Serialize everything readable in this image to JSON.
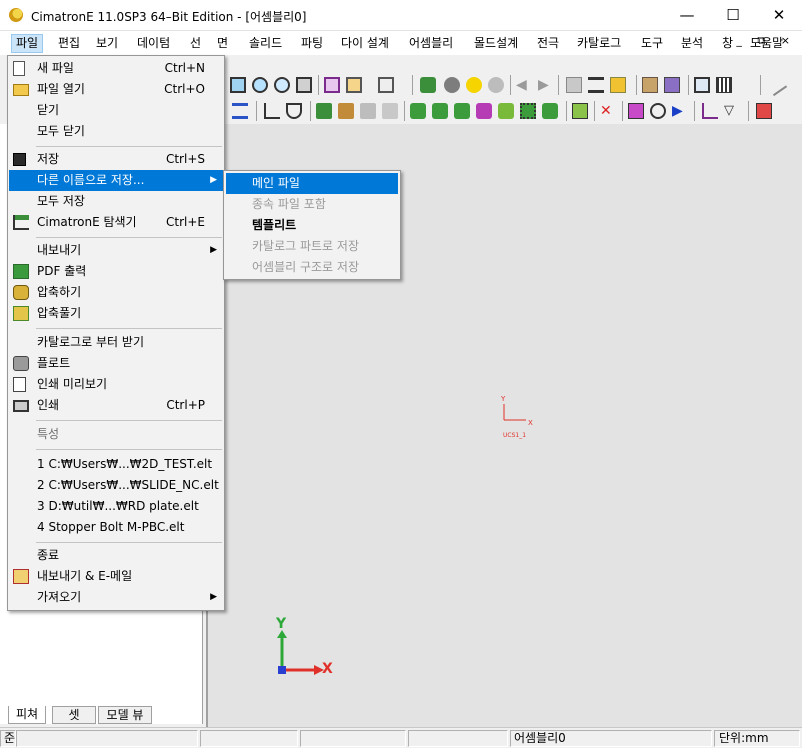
{
  "window": {
    "title": "CimatronE 11.0SP3 64–Bit Edition - [어셈블리0]",
    "minimize_glyph": "—",
    "maximize_glyph": "☐",
    "close_glyph": "✕",
    "mdi_controls": "_ ⧉ ×"
  },
  "menubar": {
    "items": [
      "파일",
      "편집",
      "보기",
      "데이텀",
      "선",
      "면",
      "솔리드",
      "파팅",
      "다이 설계",
      "어셈블리",
      "몰드설계",
      "전극",
      "카탈로그",
      "도구",
      "분석",
      "창",
      "도움말"
    ],
    "active_index": 0
  },
  "file_menu": {
    "items": [
      {
        "label": "새 파일",
        "shortcut": "Ctrl+N",
        "icon": "new-file-icon"
      },
      {
        "label": "파일 열기",
        "shortcut": "Ctrl+O",
        "icon": "open-folder-icon"
      },
      {
        "label": "닫기",
        "shortcut": ""
      },
      {
        "label": "모두 닫기",
        "shortcut": ""
      },
      {
        "label": "저장",
        "shortcut": "Ctrl+S",
        "icon": "floppy-disk-icon"
      },
      {
        "label": "다른 이름으로 저장...",
        "shortcut": "",
        "submenu": true
      },
      {
        "label": "모두 저장",
        "shortcut": ""
      },
      {
        "label": "CimatronE 탐색기",
        "shortcut": "Ctrl+E",
        "icon": "explorer-tree-icon"
      },
      {
        "label": "내보내기",
        "shortcut": "",
        "submenu": true
      },
      {
        "label": "PDF 출력",
        "shortcut": "",
        "icon": "pdf-output-icon"
      },
      {
        "label": "압축하기",
        "shortcut": "",
        "icon": "compress-icon"
      },
      {
        "label": "압축풀기",
        "shortcut": "",
        "icon": "extract-icon"
      },
      {
        "label": "카탈로그로 부터 받기",
        "shortcut": ""
      },
      {
        "label": "플로트",
        "shortcut": "",
        "icon": "plotter-icon"
      },
      {
        "label": "인쇄 미리보기",
        "shortcut": "",
        "icon": "print-preview-icon"
      },
      {
        "label": "인쇄",
        "shortcut": "Ctrl+P",
        "icon": "printer-icon"
      },
      {
        "label": "특성",
        "shortcut": "",
        "disabled": true
      },
      {
        "label": "1 C:₩Users₩...₩2D_TEST.elt",
        "shortcut": ""
      },
      {
        "label": "2 C:₩Users₩...₩SLIDE_NC.elt",
        "shortcut": ""
      },
      {
        "label": "3 D:₩util₩...₩RD plate.elt",
        "shortcut": ""
      },
      {
        "label": "4 Stopper Bolt M-PBC.elt",
        "shortcut": ""
      },
      {
        "label": "종료",
        "shortcut": ""
      },
      {
        "label": "내보내기 & E-메일",
        "shortcut": "",
        "icon": "export-email-icon"
      },
      {
        "label": "가져오기",
        "shortcut": "",
        "submenu": true
      }
    ],
    "highlighted_index": 5,
    "submenu_arrow": "▶"
  },
  "save_as_submenu": {
    "items": [
      {
        "label": "메인 파일",
        "state": "highlighted"
      },
      {
        "label": "종속 파일 포함",
        "state": "disabled"
      },
      {
        "label": "템플리트",
        "state": "bold"
      },
      {
        "label": "카탈로그 파트로 저장",
        "state": "disabled"
      },
      {
        "label": "어셈블리 구조로 저장",
        "state": "disabled"
      }
    ]
  },
  "panel_tabs": [
    "피쳐",
    "셋",
    "모델 뷰"
  ],
  "viewport": {
    "ucs_label": "UCS1_1",
    "ucs_x": "X",
    "ucs_y": "Y",
    "triad_x": "X",
    "triad_y": "Y"
  },
  "statusbar": {
    "left_text": "준",
    "mode": "어셈블리0",
    "units": "단위:mm"
  },
  "colors": {
    "highlight": "#0078d7",
    "viewport_bg": "#e3e3e3",
    "axis_x": "#e0302a",
    "axis_y": "#2fa83a",
    "axis_z": "#2a3fd0"
  }
}
